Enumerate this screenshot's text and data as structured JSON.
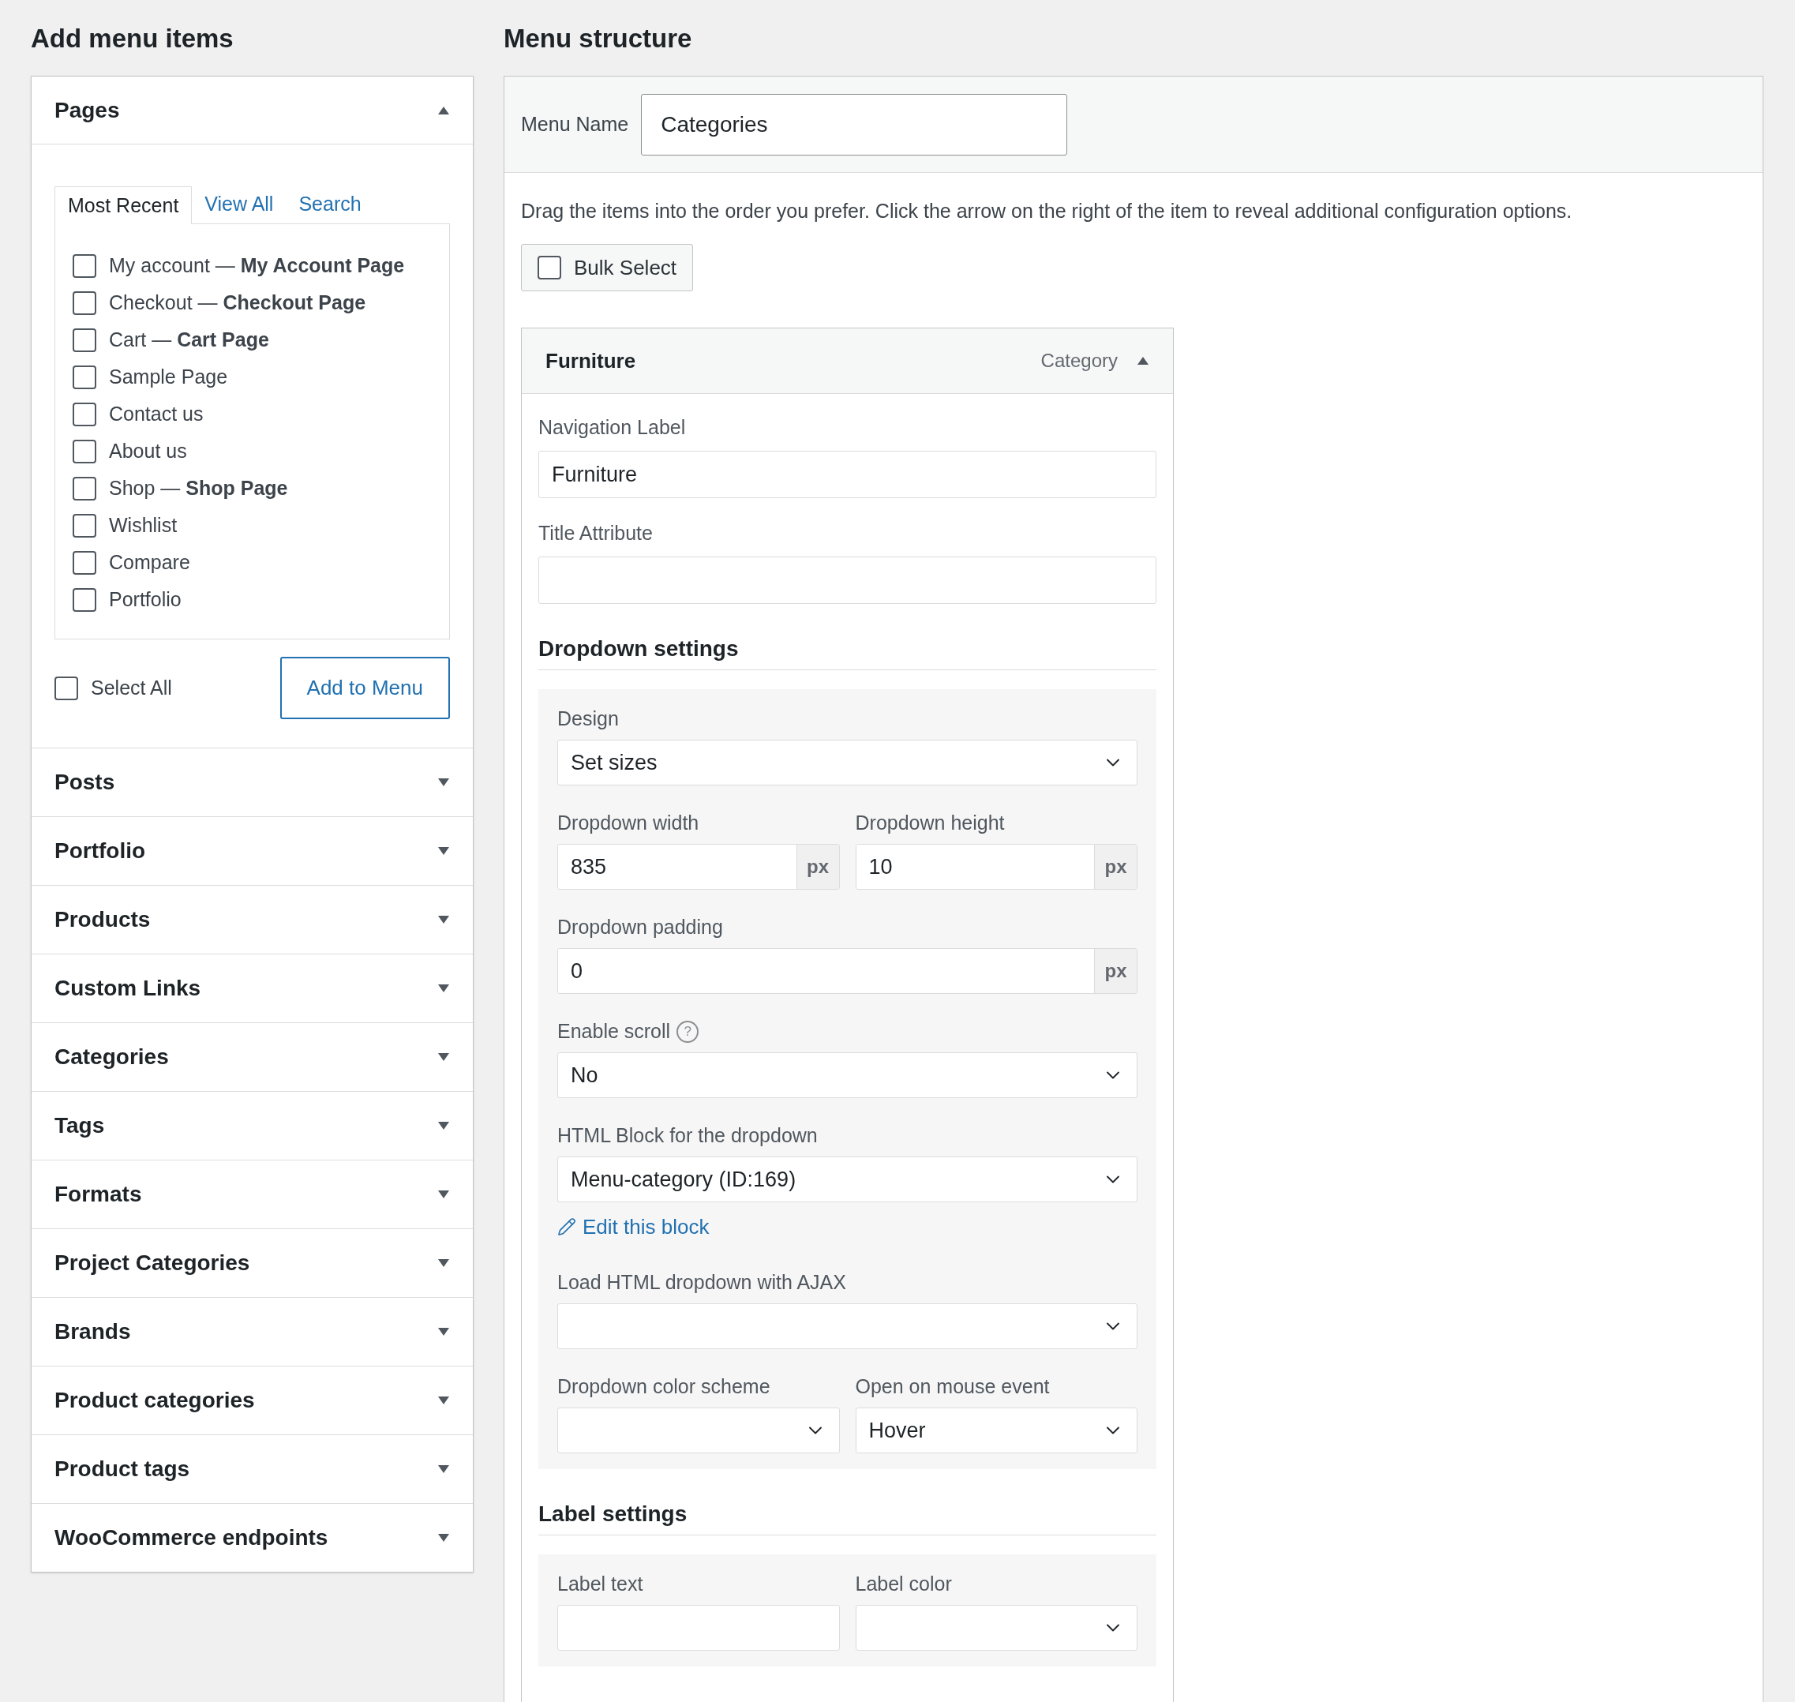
{
  "left": {
    "title": "Add menu items",
    "sections": [
      {
        "title": "Pages",
        "expanded": true,
        "tabs": [
          {
            "label": "Most Recent",
            "selected": true
          },
          {
            "label": "View All",
            "selected": false
          },
          {
            "label": "Search",
            "selected": false
          }
        ],
        "items": [
          {
            "label": "My account — **My Account Page**",
            "checked": false
          },
          {
            "label": "Checkout — **Checkout Page**",
            "checked": false
          },
          {
            "label": "Cart — **Cart Page**",
            "checked": false
          },
          {
            "label": "Sample Page",
            "checked": false
          },
          {
            "label": "Contact us",
            "checked": false
          },
          {
            "label": "About us",
            "checked": false
          },
          {
            "label": "Shop — **Shop Page**",
            "checked": false
          },
          {
            "label": "Wishlist",
            "checked": false
          },
          {
            "label": "Compare",
            "checked": false
          },
          {
            "label": "Portfolio",
            "checked": false
          }
        ],
        "select_all": {
          "label": "Select All",
          "checked": false
        },
        "button": "Add to Menu"
      },
      {
        "title": "Posts",
        "expanded": false
      },
      {
        "title": "Portfolio",
        "expanded": false
      },
      {
        "title": "Products",
        "expanded": false
      },
      {
        "title": "Custom Links",
        "expanded": false
      },
      {
        "title": "Categories",
        "expanded": false
      },
      {
        "title": "Tags",
        "expanded": false
      },
      {
        "title": "Formats",
        "expanded": false
      },
      {
        "title": "Project Categories",
        "expanded": false
      },
      {
        "title": "Brands",
        "expanded": false
      },
      {
        "title": "Product categories",
        "expanded": false
      },
      {
        "title": "Product tags",
        "expanded": false
      },
      {
        "title": "WooCommerce endpoints",
        "expanded": false
      }
    ]
  },
  "right": {
    "title": "Menu structure",
    "menu_name": {
      "label": "Menu Name",
      "value": "Categories"
    },
    "instructions": "Drag the items into the order you prefer. Click the arrow on the right of the item to reveal additional configuration options.",
    "bulk_select": {
      "label": "Bulk Select",
      "checked": false
    },
    "item": {
      "title": "Furniture",
      "type": "Category",
      "expanded": true,
      "navigation_label": {
        "label": "Navigation Label",
        "value": "Furniture"
      },
      "title_attribute": {
        "label": "Title Attribute"
      },
      "groups": [
        {
          "title": "Dropdown settings",
          "rows": [
            {
              "fields": [
                {
                  "kind": "select",
                  "label": "Design",
                  "value": "Set sizes"
                }
              ]
            },
            {
              "fields": [
                {
                  "kind": "unit",
                  "label": "Dropdown width",
                  "value": "835",
                  "unit": "px"
                },
                {
                  "kind": "unit",
                  "label": "Dropdown height",
                  "value": "10",
                  "unit": "px"
                }
              ]
            },
            {
              "fields": [
                {
                  "kind": "unit",
                  "label": "Dropdown padding",
                  "value": "0",
                  "unit": "px"
                }
              ]
            },
            {
              "fields": [
                {
                  "kind": "select",
                  "label": "Enable scroll",
                  "help": "?",
                  "value": "No"
                }
              ]
            },
            {
              "fields": [
                {
                  "kind": "select",
                  "label": "HTML Block for the dropdown",
                  "value": "Menu-category (ID:169)",
                  "link": "Edit this block"
                }
              ]
            },
            {
              "fields": [
                {
                  "kind": "select",
                  "label": "Load HTML dropdown with AJAX"
                }
              ]
            },
            {
              "fields": [
                {
                  "kind": "select",
                  "label": "Dropdown color scheme"
                },
                {
                  "kind": "select",
                  "label": "Open on mouse event",
                  "value": "Hover"
                }
              ]
            }
          ]
        },
        {
          "title": "Label settings",
          "rows": [
            {
              "fields": [
                {
                  "kind": "text",
                  "label": "Label text"
                },
                {
                  "kind": "select",
                  "label": "Label color"
                }
              ]
            }
          ]
        }
      ]
    }
  }
}
